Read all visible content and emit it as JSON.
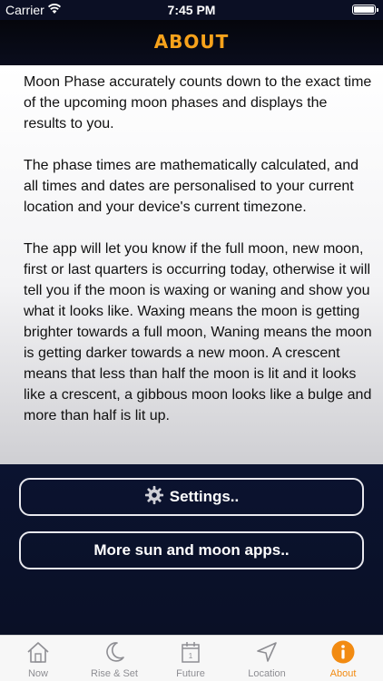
{
  "status": {
    "carrier": "Carrier",
    "time": "7:45 PM"
  },
  "header": {
    "title": "ABOUT"
  },
  "about": {
    "paragraphs": [
      "Moon Phase accurately counts down to the exact time of the upcoming moon phases and displays the results to you.",
      "The phase times are mathematically calculated, and all times and dates are personalised to your current location and your device's current timezone.",
      "The app will let you know if the full moon, new moon, first or last quarters is occurring today, otherwise it will tell you if the moon is waxing or waning and show you what it looks like. Waxing means the moon is getting brighter towards a full moon, Waning means the moon is getting darker towards a new moon. A crescent means that less than half the moon is lit and it looks like a crescent, a gibbous moon looks like a bulge and more than half is lit up."
    ]
  },
  "buttons": {
    "settings": "Settings..",
    "more_apps": "More sun and moon apps.."
  },
  "tabs": [
    {
      "label": "Now",
      "icon": "house-icon"
    },
    {
      "label": "Rise & Set",
      "icon": "crescent-moon-icon"
    },
    {
      "label": "Future",
      "icon": "calendar-icon"
    },
    {
      "label": "Location",
      "icon": "location-arrow-icon"
    },
    {
      "label": "About",
      "icon": "info-icon"
    }
  ],
  "colors": {
    "accent": "#f28b12",
    "title": "#f7a21b",
    "inactive_tab": "#8e8e93"
  }
}
